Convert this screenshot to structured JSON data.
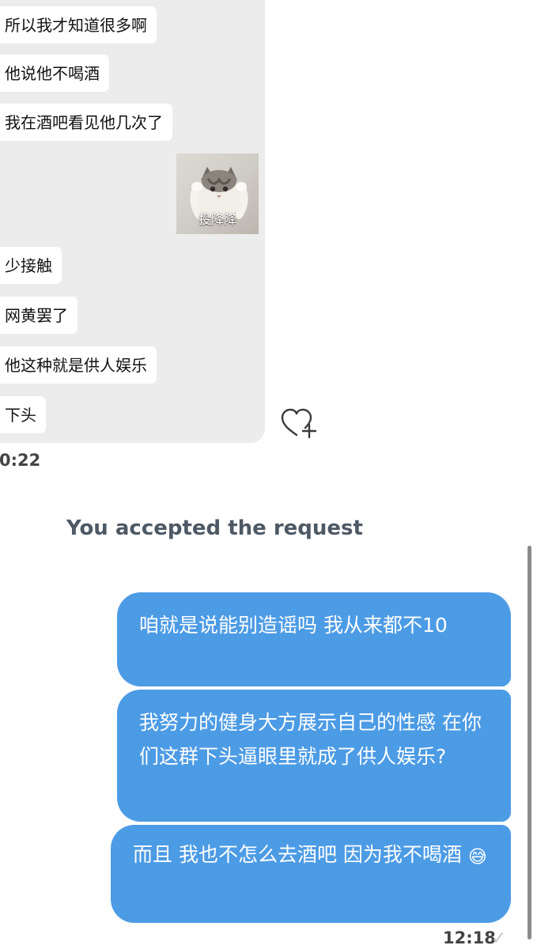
{
  "incoming": {
    "messages": [
      "所以我才知道很多啊",
      "他说他不喝酒",
      "我在酒吧看见他几次了",
      "少接触",
      "网黄罢了",
      "他这种就是供人娱乐",
      "下头"
    ],
    "sticker_caption": "投降降",
    "time": "0:22"
  },
  "notice": "You accepted the request",
  "outgoing": {
    "messages": [
      "咱就是说能别造谣吗 我从来都不10",
      "我努力的健身大方展示自己的性感 在你们这群下头逼眼里就成了供人娱乐?",
      "而且 我也不怎么去酒吧 因为我不喝酒"
    ],
    "emoji": "😅",
    "time": "12:18",
    "read_icon": "✓"
  },
  "colors": {
    "outgoing_bubble": "#4c9be5",
    "incoming_panel": "#ececec",
    "notice_text": "#4d5965"
  },
  "icons": {
    "heart_plus": "heart-plus-icon",
    "checkmark": "checkmark-icon"
  }
}
